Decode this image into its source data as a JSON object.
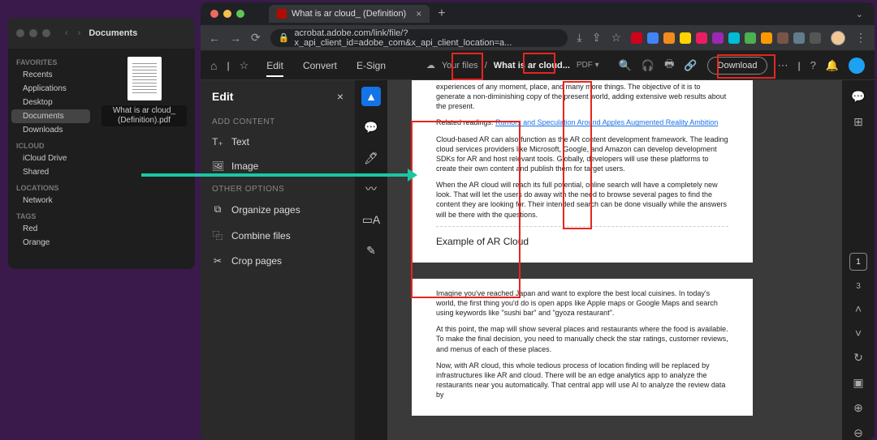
{
  "finder": {
    "title": "Documents",
    "sections": {
      "favorites": "Favorites",
      "icloud": "iCloud",
      "locations": "Locations",
      "tags": "Tags"
    },
    "items": {
      "recents": "Recents",
      "applications": "Applications",
      "desktop": "Desktop",
      "documents": "Documents",
      "downloads": "Downloads",
      "iclouddrive": "iCloud Drive",
      "shared": "Shared",
      "network": "Network",
      "red": "Red",
      "orange": "Orange"
    },
    "file": {
      "line1": "What is ar cloud_",
      "line2": "(Definition).pdf"
    }
  },
  "browser": {
    "tab_title": "What is ar cloud_ (Definition)",
    "url": "acrobat.adobe.com/link/file/?x_api_client_id=adobe_com&x_api_client_location=a..."
  },
  "acrobat": {
    "tabs": {
      "edit": "Edit",
      "convert": "Convert",
      "esign": "E-Sign"
    },
    "breadcrumb": {
      "yourfiles": "Your files",
      "filename": "What is ar cloud...",
      "type": "PDF"
    },
    "download": "Download",
    "panel": {
      "title": "Edit",
      "add_content": "ADD CONTENT",
      "text": "Text",
      "image": "Image",
      "other_options": "OTHER OPTIONS",
      "organize": "Organize pages",
      "combine": "Combine files",
      "crop": "Crop pages"
    },
    "pages": {
      "current": "1",
      "total": "3"
    }
  },
  "document": {
    "page1": {
      "intro": "experiences of any moment, place, and many more things. The objective of it is to generate a non-diminishing copy of the present world, adding extensive web results about the present.",
      "related_label": "Related readings:",
      "related_link": "Rumors and Speculation Around Apples Augmented Reality Ambition",
      "p2": "Cloud-based AR can also function as the AR content development framework. The leading cloud services providers like Microsoft, Google, and Amazon can develop development SDKs for AR and host relevant tools. Globally, developers will use these platforms to create their own content and publish them for target users.",
      "p3": "When the AR cloud will reach its full potential, online search will have a completely new look. That will let the users do away with the need to browse several pages to find the content they are looking for. Their intended search can be done visually while the answers will be there with the questions.",
      "heading": "Example of AR Cloud"
    },
    "page2": {
      "p1": "Imagine you've reached Japan and want to explore the best local cuisines. In today's world, the first thing you'd do is open apps like Apple maps or Google Maps and search using keywords like \"sushi bar\" and \"gyoza restaurant\".",
      "p2": "At this point, the map will show several places and restaurants where the food is available. To make the final decision, you need to manually check the star ratings, customer reviews, and menus of each of these places.",
      "p3": "Now, with AR cloud, this whole tedious process of location finding will be replaced by infrastructures like AR and cloud. There will be an edge analytics app to analyze the restaurants near you automatically. That central app will use AI to analyze the review data by"
    }
  }
}
